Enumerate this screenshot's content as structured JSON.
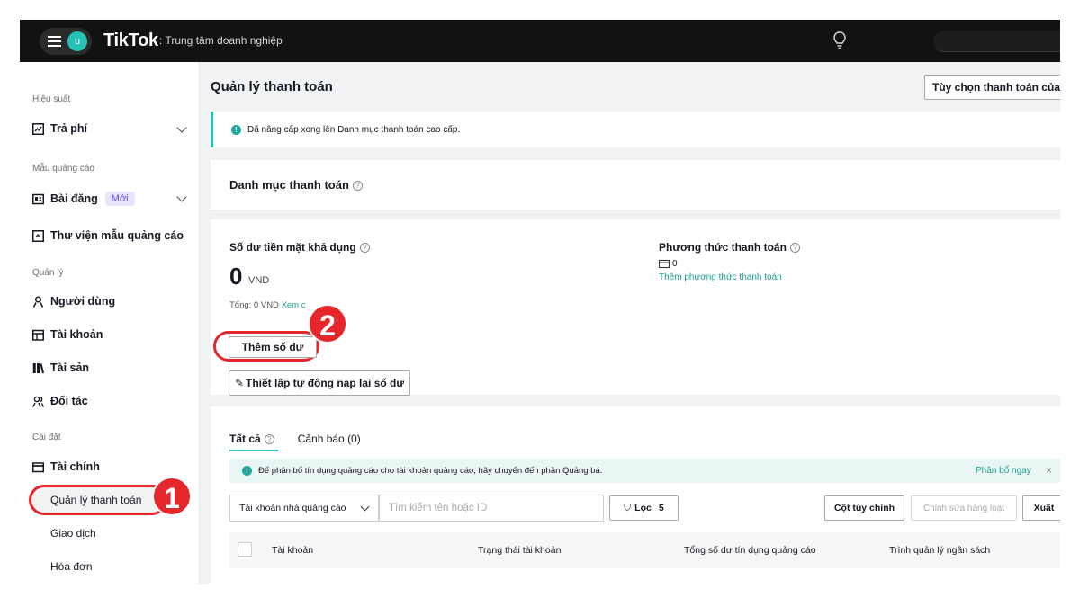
{
  "topbar": {
    "avatar_letter": "u",
    "brand": "TikTok",
    "brand_sub": ": Trung tâm doanh nghiệp"
  },
  "sidebar": {
    "section_performance": "Hiệu suất",
    "item_paid": "Trả phí",
    "section_templates": "Mẫu quảng cáo",
    "item_posts": "Bài đăng",
    "item_posts_badge": "Mới",
    "item_library": "Thư viện mẫu quảng cáo",
    "section_manage": "Quản lý",
    "item_users": "Người dùng",
    "item_accounts": "Tài khoản",
    "item_assets": "Tài sản",
    "item_partners": "Đối tác",
    "section_settings": "Cài đặt",
    "item_finance": "Tài chính",
    "sub_payment_mgmt": "Quản lý thanh toán",
    "sub_transactions": "Giao dịch",
    "sub_invoices": "Hóa đơn"
  },
  "callouts": {
    "one": "1",
    "two": "2"
  },
  "main": {
    "title": "Quản lý thanh toán",
    "options_button": "Tùy chọn thanh toán của",
    "banner_text": "Đã nâng cấp xong lên Danh mục thanh toán cao cấp.",
    "portfolio_title": "Danh mục thanh toán",
    "balance_label": "Số dư tiền mặt khả dụng",
    "balance_value": "0",
    "balance_currency": "VND",
    "total_text": "Tổng: 0 VND",
    "view_link": "Xem c",
    "add_balance_button": "Thêm số dư",
    "auto_reload_button": "Thiết lập tự động nạp lại số dư",
    "payment_method_label": "Phương thức thanh toán",
    "payment_method_count": "0",
    "add_payment_link": "Thêm phương thức thanh toán"
  },
  "list": {
    "tab_all": "Tất cả",
    "tab_alerts": "Cảnh báo (0)",
    "notice_text": "Để phân bổ tín dụng quảng cáo cho tài khoản quảng cáo, hãy chuyển đến phần Quảng bá.",
    "notice_link": "Phân bổ ngay",
    "account_select": "Tài khoản nhà quảng cáo",
    "search_placeholder": "Tìm kiếm tên hoặc ID",
    "filter_label": "Lọc",
    "filter_count": "5",
    "custom_columns": "Cột tùy chỉnh",
    "bulk_edit": "Chỉnh sửa hàng loạt",
    "export": "Xuất",
    "col_account": "Tài khoản",
    "col_status": "Trạng thái tài khoản",
    "col_credit": "Tổng số dư tín dụng quảng cáo",
    "col_budget": "Trình quản lý ngân sách"
  }
}
